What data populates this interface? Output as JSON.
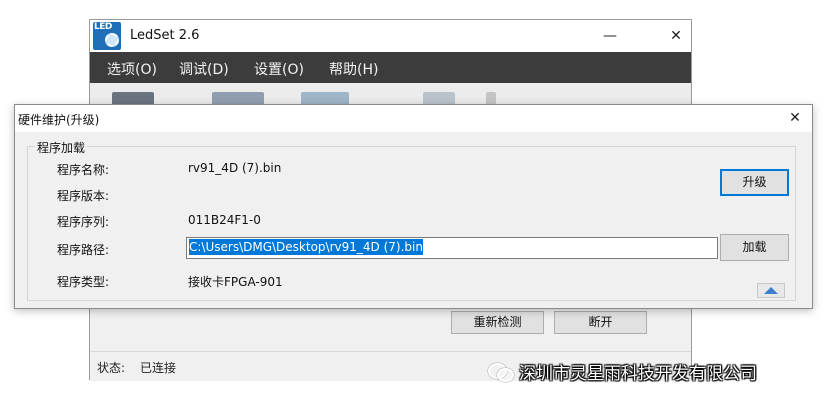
{
  "main_window": {
    "icon_text": "LED",
    "title": "LedSet 2.6",
    "minimize_glyph": "—",
    "close_glyph": "✕",
    "menu": [
      "选项(O)",
      "调试(D)",
      "设置(O)",
      "帮助(H)"
    ],
    "buttons": {
      "redetect": "重新检测",
      "disconnect": "断开"
    },
    "status": {
      "label": "状态:",
      "value": "已连接"
    }
  },
  "dialog": {
    "title": "硬件维护(升级)",
    "close_glyph": "✕",
    "group_title": "程序加载",
    "fields": {
      "name": {
        "label": "程序名称:",
        "value": "rv91_4D (7).bin"
      },
      "version": {
        "label": "程序版本:",
        "value": ""
      },
      "serial": {
        "label": "程序序列:",
        "value": "011B24F1-0"
      },
      "path": {
        "label": "程序路径:",
        "value": "C:\\Users\\DMG\\Desktop\\rv91_4D (7).bin"
      },
      "type": {
        "label": "程序类型:",
        "value": "接收卡FPGA-901"
      }
    },
    "buttons": {
      "upgrade": "升级",
      "load": "加载"
    }
  },
  "watermark": {
    "text": "深圳市灵星雨科技开发有限公司"
  },
  "colors": {
    "menubar_bg": "#3c3c3c",
    "selection": "#0078d7",
    "window_bg": "#f0f0f0",
    "default_button_border": "#0078d7"
  },
  "icons": [
    "led-app-icon",
    "minimize-icon",
    "close-icon",
    "collapse-up-icon",
    "wechat-icon"
  ]
}
